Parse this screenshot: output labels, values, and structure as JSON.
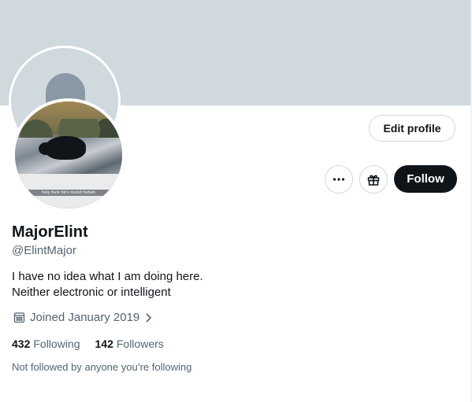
{
  "profile": {
    "display_name": "MajorElint",
    "handle": "@ElintMajor",
    "bio_lines": [
      "I have no idea what I am doing here.",
      "Neither electronic or intelligent"
    ],
    "joined": "Joined January 2019",
    "following_count": "432",
    "following_label": "Following",
    "followers_count": "142",
    "followers_label": "Followers",
    "not_followed_note": "Not followed by anyone you’re following"
  },
  "avatar": {
    "caption": "holy fuck he's round hehah"
  },
  "actions": {
    "edit_profile_label": "Edit profile",
    "follow_label": "Follow",
    "more_icon": "more-horizontal-icon",
    "gift_icon": "gift-icon"
  },
  "colors": {
    "banner": "#cfd9de",
    "follow_button": "#0f1419",
    "secondary_text": "#536471"
  }
}
